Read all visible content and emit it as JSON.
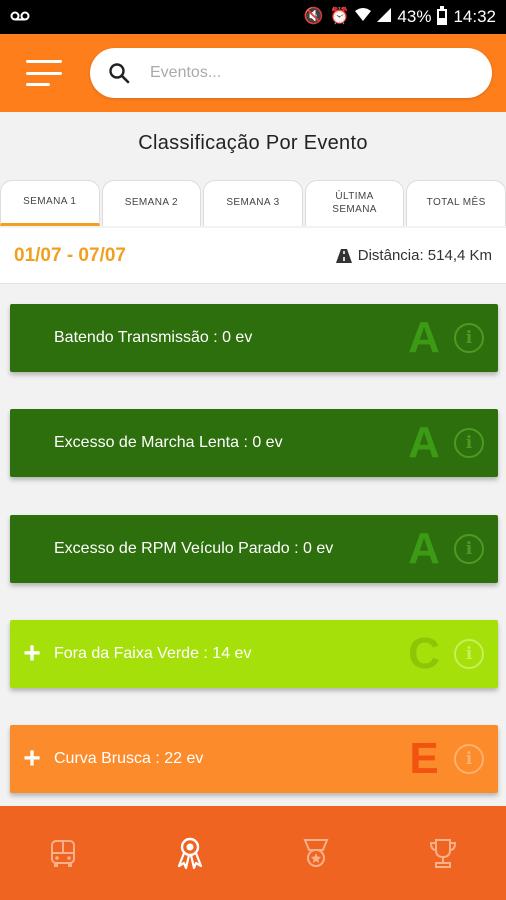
{
  "status_bar": {
    "battery": "43%",
    "time": "14:32"
  },
  "header": {
    "search_placeholder": "Eventos..."
  },
  "page": {
    "title": "Classificação Por Evento"
  },
  "tabs": [
    {
      "label": "SEMANA 1",
      "active": true
    },
    {
      "label": "SEMANA 2",
      "active": false
    },
    {
      "label": "SEMANA 3",
      "active": false
    },
    {
      "label": "ÚLTIMA\nSEMANA",
      "active": false
    },
    {
      "label": "TOTAL MÊS",
      "active": false
    }
  ],
  "week": {
    "range": "01/07 - 07/07",
    "distance": "Distância: 514,4 Km"
  },
  "events": [
    {
      "label": "Batendo Transmissão : 0 ev",
      "grade": "A",
      "expandable": false,
      "bg": "#2e6f0d",
      "grade_color": "#3d9a14",
      "info_color": "#4c9a23"
    },
    {
      "label": "Excesso de Marcha Lenta : 0 ev",
      "grade": "A",
      "expandable": false,
      "bg": "#2e6f0d",
      "grade_color": "#3d9a14",
      "info_color": "#4c9a23"
    },
    {
      "label": "Excesso de RPM Veículo Parado : 0 ev",
      "grade": "A",
      "expandable": false,
      "bg": "#2e6f0d",
      "grade_color": "#3d9a14",
      "info_color": "#4c9a23"
    },
    {
      "label": "Fora da Faixa Verde : 14 ev",
      "grade": "C",
      "expandable": true,
      "bg": "#a6e00a",
      "grade_color": "#8fc407",
      "info_color": "#c8ef55"
    },
    {
      "label": "Curva Brusca : 22 ev",
      "grade": "E",
      "expandable": true,
      "bg": "#fb8b2b",
      "grade_color": "#f2540f",
      "info_color": "#ffb070"
    }
  ],
  "bottom_nav": [
    "bus-icon",
    "award-ribbon-icon",
    "badge-icon",
    "trophy-icon"
  ],
  "colors": {
    "header_orange": "#fe7e1b",
    "nav_orange": "#f06422",
    "accent_gold": "#f0a020"
  }
}
